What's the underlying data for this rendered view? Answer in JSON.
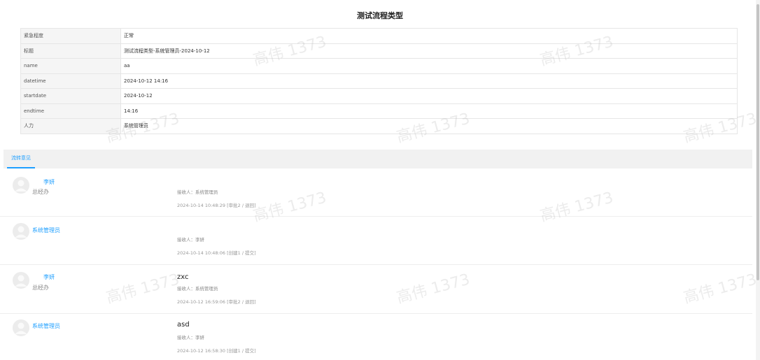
{
  "title": "测试流程类型",
  "info_rows": [
    {
      "label": "紧急程度",
      "value": "正常"
    },
    {
      "label": "标题",
      "value": "测试流程类型-系统管理员-2024-10-12"
    },
    {
      "label": "name",
      "value": "aa"
    },
    {
      "label": "datetime",
      "value": "2024-10-12 14:16"
    },
    {
      "label": "startdate",
      "value": "2024-10-12"
    },
    {
      "label": "endtime",
      "value": "14:16"
    },
    {
      "label": "人力",
      "value": "系统管理员"
    }
  ],
  "tabs": [
    {
      "label": "流转意见"
    }
  ],
  "records": [
    {
      "name": "李妍",
      "dept": "总经办",
      "comment": "",
      "receiver": "接收人：系统管理员",
      "time": "2024-10-14 10:48:29  [审批2 / 退回]"
    },
    {
      "name": "系统管理员",
      "dept": "",
      "comment": "",
      "receiver": "接收人：李妍",
      "time": "2024-10-14 10:48:06  [创建1 / 提交]"
    },
    {
      "name": "李妍",
      "dept": "总经办",
      "comment": "zxc",
      "receiver": "接收人：系统管理员",
      "time": "2024-10-12 16:59:06  [审批2 / 退回]"
    },
    {
      "name": "系统管理员",
      "dept": "",
      "comment": "asd",
      "receiver": "接收人：李妍",
      "time": "2024-10-12 16:58:30  [创建1 / 提交]"
    }
  ],
  "watermark": "高伟 1373"
}
